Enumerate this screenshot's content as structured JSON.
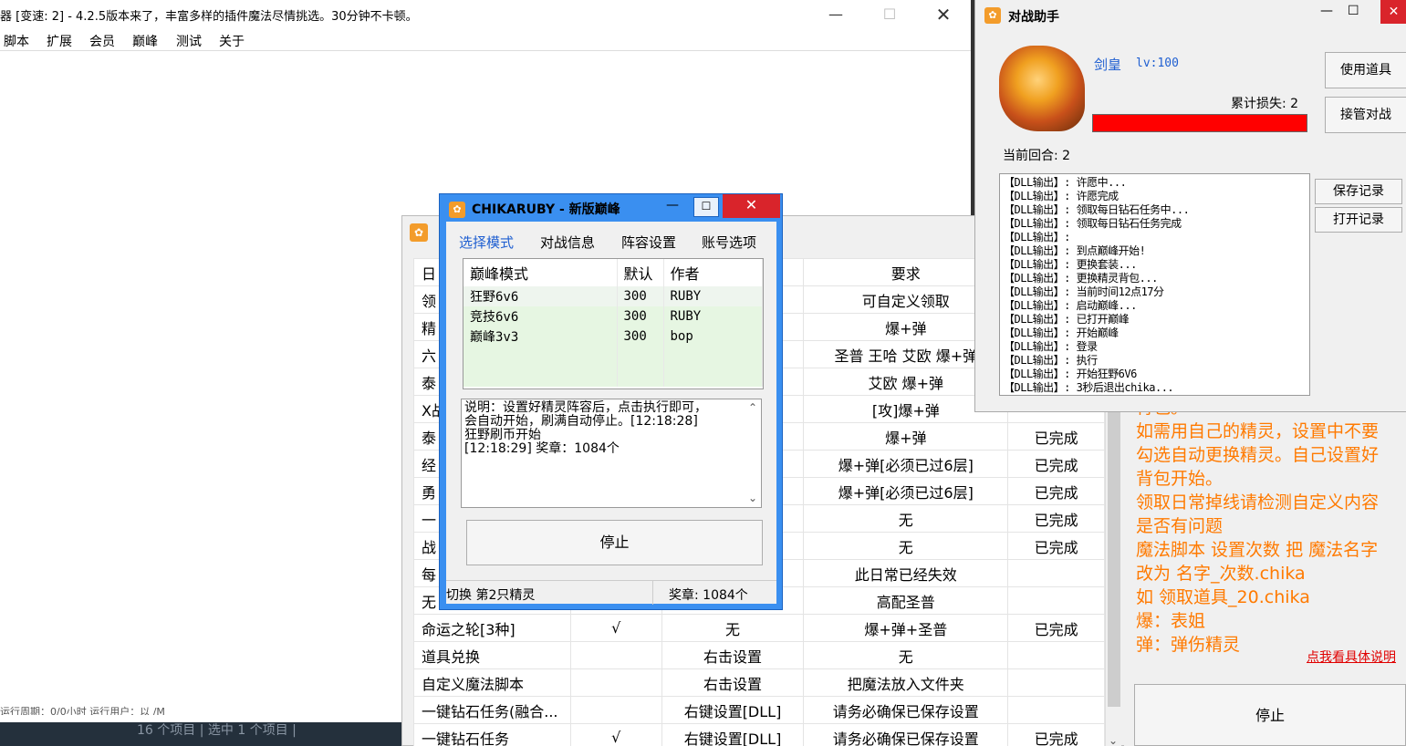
{
  "main_window": {
    "title": "器 [变速: 2] - 4.2.5版本来了，丰富多样的插件魔法尽情挑选。30分钟不卡顿。",
    "menu": [
      "脚本",
      "扩展",
      "会员",
      "巅峰",
      "测试",
      "关于"
    ],
    "status_fragment": "运行周期：0/0小时    运行用户：以 /M",
    "taskbar_text": "16 个项目  |  选中 1 个项目  |"
  },
  "tasks": {
    "header": [
      "日",
      "要求"
    ],
    "rows": [
      {
        "name": "领",
        "star": "",
        "setting": "",
        "req": "可自定义领取",
        "status": ""
      },
      {
        "name": "精",
        "star": "",
        "setting": "",
        "req": "爆+弹",
        "status": ""
      },
      {
        "name": "六",
        "star": "",
        "setting": "",
        "req": "圣普 王哈 艾欧 爆+弹",
        "status": ""
      },
      {
        "name": "泰",
        "star": "",
        "setting": "",
        "req": "艾欧 爆+弹",
        "status": ""
      },
      {
        "name": "X战",
        "star": "",
        "setting": "",
        "req": "[攻]爆+弹",
        "status": ""
      },
      {
        "name": "泰",
        "star": "",
        "setting": "",
        "req": "爆+弹",
        "status": "已完成"
      },
      {
        "name": "经",
        "star": "",
        "setting": "",
        "req": "爆+弹[必须已过6层]",
        "status": "已完成"
      },
      {
        "name": "勇",
        "star": "",
        "setting": "",
        "req": "爆+弹[必须已过6层]",
        "status": "已完成"
      },
      {
        "name": "一",
        "star": "",
        "setting": "",
        "req": "无",
        "status": "已完成"
      },
      {
        "name": "战",
        "star": "",
        "setting": "",
        "req": "无",
        "status": "已完成"
      },
      {
        "name": "每",
        "star": "",
        "setting": "",
        "req": "此日常已经失效",
        "status": ""
      },
      {
        "name": "无",
        "star": "",
        "setting": "",
        "req": "高配圣普",
        "status": ""
      },
      {
        "name": "命运之轮[3种]",
        "star": "√",
        "setting": "无",
        "req": "爆+弹+圣普",
        "status": "已完成"
      },
      {
        "name": "道具兑换",
        "star": "",
        "setting": "右击设置",
        "req": "无",
        "status": ""
      },
      {
        "name": "自定义魔法脚本",
        "star": "",
        "setting": "右击设置",
        "req": "把魔法放入文件夹",
        "status": ""
      },
      {
        "name": "一键钻石任务(融合...",
        "star": "",
        "setting": "右键设置[DLL]",
        "req": "请务必确保已保存设置",
        "status": ""
      },
      {
        "name": "一键钻石任务",
        "star": "√",
        "setting": "右键设置[DLL]",
        "req": "请务必确保已保存设置",
        "status": "已完成"
      }
    ]
  },
  "right_panel": {
    "lines": [
      "背包。",
      "如需用自己的精灵，设置中不要",
      "勾选自动更换精灵。自己设置好",
      "背包开始。",
      "领取日常掉线请检测自定义内容",
      "是否有问题",
      "魔法脚本 设置次数 把 魔法名字",
      "改为 名字_次数.chika",
      "如 领取道具_20.chika",
      "爆：表姐",
      "弹：弹伤精灵"
    ],
    "help_link": "点我看具体说明",
    "stop_label": "停止"
  },
  "battle": {
    "title": "对战助手",
    "hero_name": "剑皇",
    "hero_level": "lv:100",
    "loss_label": "累计损失: 2",
    "hp_fraction": 1.0,
    "round_label": "当前回合: 2",
    "use_item_label": "使用道具",
    "takeover_label": "接管对战",
    "save_log_label": "保存记录",
    "open_log_label": "打开记录",
    "log": [
      "【DLL输出】: 许愿中...",
      "【DLL输出】: 许愿完成",
      "【DLL输出】: 领取每日钻石任务中...",
      "【DLL输出】: 领取每日钻石任务完成",
      "【DLL输出】:",
      "【DLL输出】: 到点巅峰开始!",
      "【DLL输出】: 更换套装...",
      "【DLL输出】: 更换精灵背包...",
      "【DLL输出】: 当前时间12点17分",
      "【DLL输出】: 启动巅峰...",
      "【DLL输出】: 已打开巅峰",
      "【DLL输出】: 开始巅峰",
      "【DLL输出】: 登录",
      "【DLL输出】: 执行",
      "【DLL输出】: 开始狂野6V6",
      "【DLL输出】: 3秒后退出chika..."
    ]
  },
  "chikaruby": {
    "title": "CHIKARUBY - 新版巅峰",
    "min": "—",
    "max": "☐",
    "close": "✕",
    "tabs": [
      "选择模式",
      "对战信息",
      "阵容设置",
      "账号选项"
    ],
    "list_headers": [
      "巅峰模式",
      "默认",
      "作者"
    ],
    "list_rows": [
      {
        "mode": "狂野6v6",
        "default": "300",
        "author": "RUBY"
      },
      {
        "mode": "竞技6v6",
        "default": "300",
        "author": "RUBY"
      },
      {
        "mode": "巅峰3v3",
        "default": "300",
        "author": "bop"
      }
    ],
    "desc_lines": [
      "说明：设置好精灵阵容后，点击执行即可，",
      "会自动开始，刷满自动停止。[12:18:28]",
      "狂野刷币开始",
      "[12:18:29]    奖章：1084个"
    ],
    "stop_label": "停止",
    "status_left": "切换 第2只精灵",
    "status_right": "奖章: 1084个"
  },
  "colors": {
    "accent": "#3a8ff0",
    "close_red": "#d9242b",
    "orange_text": "#ff7a00",
    "hp_red": "#ff0000",
    "link_blue": "#1f5fd1"
  }
}
